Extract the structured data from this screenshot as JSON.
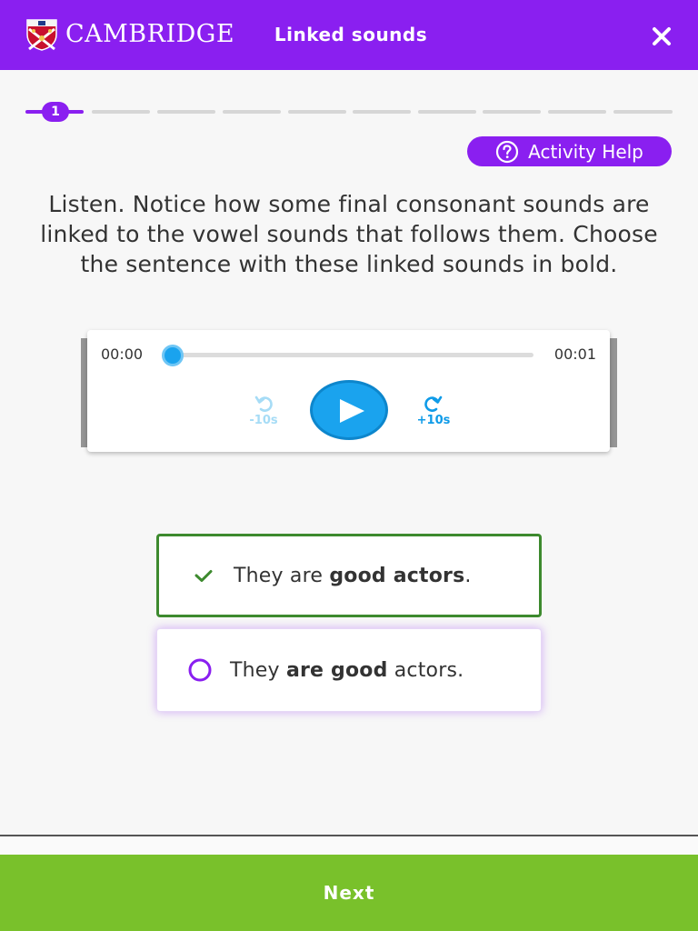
{
  "header": {
    "brand": "CAMBRIDGE",
    "title": "Linked sounds",
    "close_icon": "close-icon"
  },
  "progress": {
    "current_step": "1",
    "total_steps": 10,
    "active_color": "#8a1ff0"
  },
  "help": {
    "label": "Activity Help",
    "icon": "question-circle-icon"
  },
  "instruction": "Listen. Notice how some final consonant sounds are linked to the vowel sounds that follows them. Choose the sentence with these linked sounds in bold.",
  "player": {
    "current_time": "00:00",
    "duration": "00:01",
    "progress_fraction": 0,
    "skip_back_label": "-10s",
    "skip_forward_label": "+10s",
    "play_icon": "play-icon"
  },
  "options": [
    {
      "state": "selected-correct",
      "icon": "check-icon",
      "parts": {
        "pre": "They are ",
        "bold": "good actors",
        "post": "."
      }
    },
    {
      "state": "unselected",
      "icon": "radio-circle-icon",
      "parts": {
        "pre": "They ",
        "bold": "are good",
        "post": " actors."
      }
    }
  ],
  "footer": {
    "next_label": "Next"
  },
  "colors": {
    "brand_purple": "#8a1ff0",
    "player_blue": "#1aa3ee",
    "correct_green": "#3d8a2e",
    "next_green": "#79c12b"
  }
}
